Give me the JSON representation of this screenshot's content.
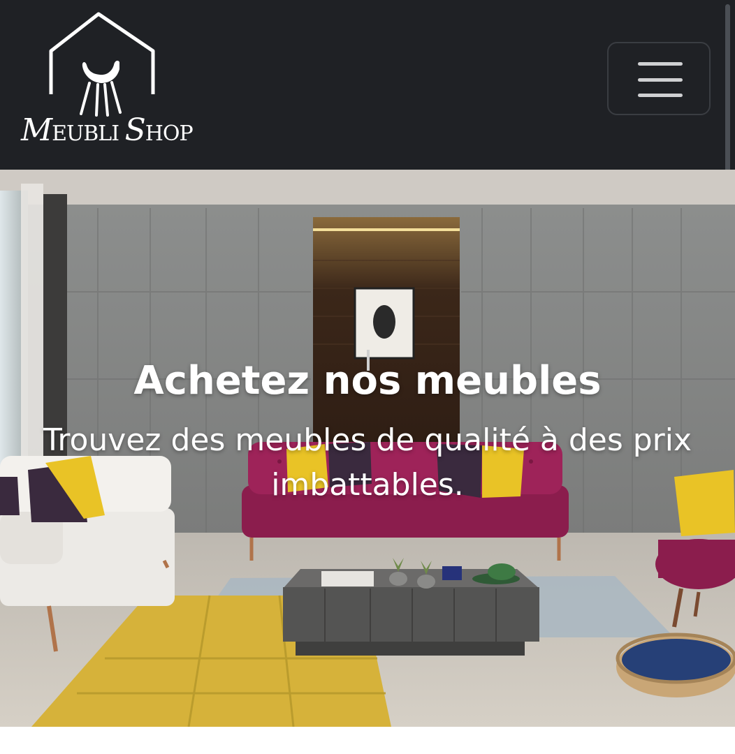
{
  "brand": {
    "name_script_1": "M",
    "name_caps_1": "EUBLI ",
    "name_script_2": "S",
    "name_caps_2": "HOP",
    "logo_icon": "house-chair-logo"
  },
  "navbar": {
    "toggler_icon": "hamburger-menu-icon",
    "background_color": "#1f2125"
  },
  "hero": {
    "title": "Achetez nos meubles",
    "subtitle": "Trouvez des meubles de qualité à des prix imbattables.",
    "text_color": "#ffffff"
  }
}
